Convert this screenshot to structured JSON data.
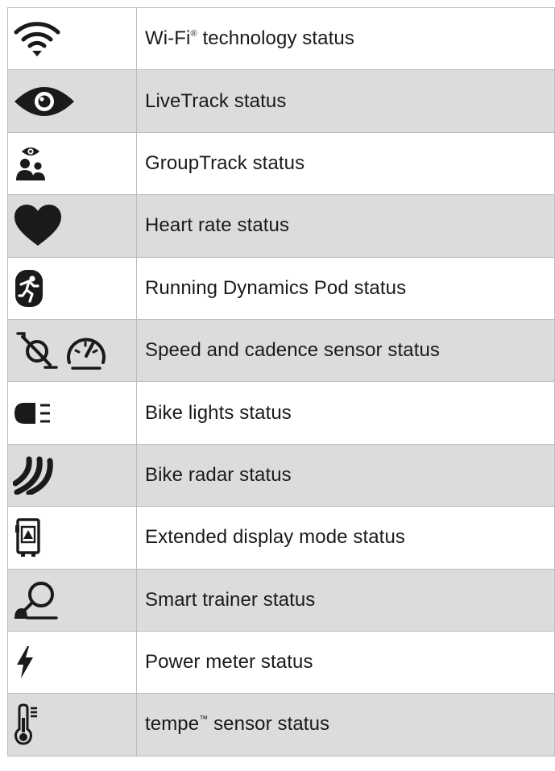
{
  "rows": [
    {
      "icon": "wifi-icon",
      "label": "Wi-Fi",
      "mark": "®",
      "suffix": " technology status"
    },
    {
      "icon": "eye-icon",
      "label": "LiveTrack status"
    },
    {
      "icon": "group-track-icon",
      "label": "GroupTrack status"
    },
    {
      "icon": "heart-icon",
      "label": "Heart rate status"
    },
    {
      "icon": "running-pod-icon",
      "label": "Running Dynamics Pod status"
    },
    {
      "icon": "speed-cadence-icon",
      "label": "Speed and cadence sensor status"
    },
    {
      "icon": "bike-light-icon",
      "label": "Bike lights status"
    },
    {
      "icon": "radar-icon",
      "label": "Bike radar status"
    },
    {
      "icon": "extended-display-icon",
      "label": "Extended display mode status"
    },
    {
      "icon": "smart-trainer-icon",
      "label": "Smart trainer status"
    },
    {
      "icon": "power-meter-icon",
      "label": "Power meter status"
    },
    {
      "icon": "thermometer-icon",
      "label": "tempe",
      "mark": "™",
      "suffix": " sensor status"
    }
  ],
  "colors": {
    "icon": "#1a1a1a",
    "stripe": "#dcdcdc",
    "border": "#bdbdbd"
  }
}
